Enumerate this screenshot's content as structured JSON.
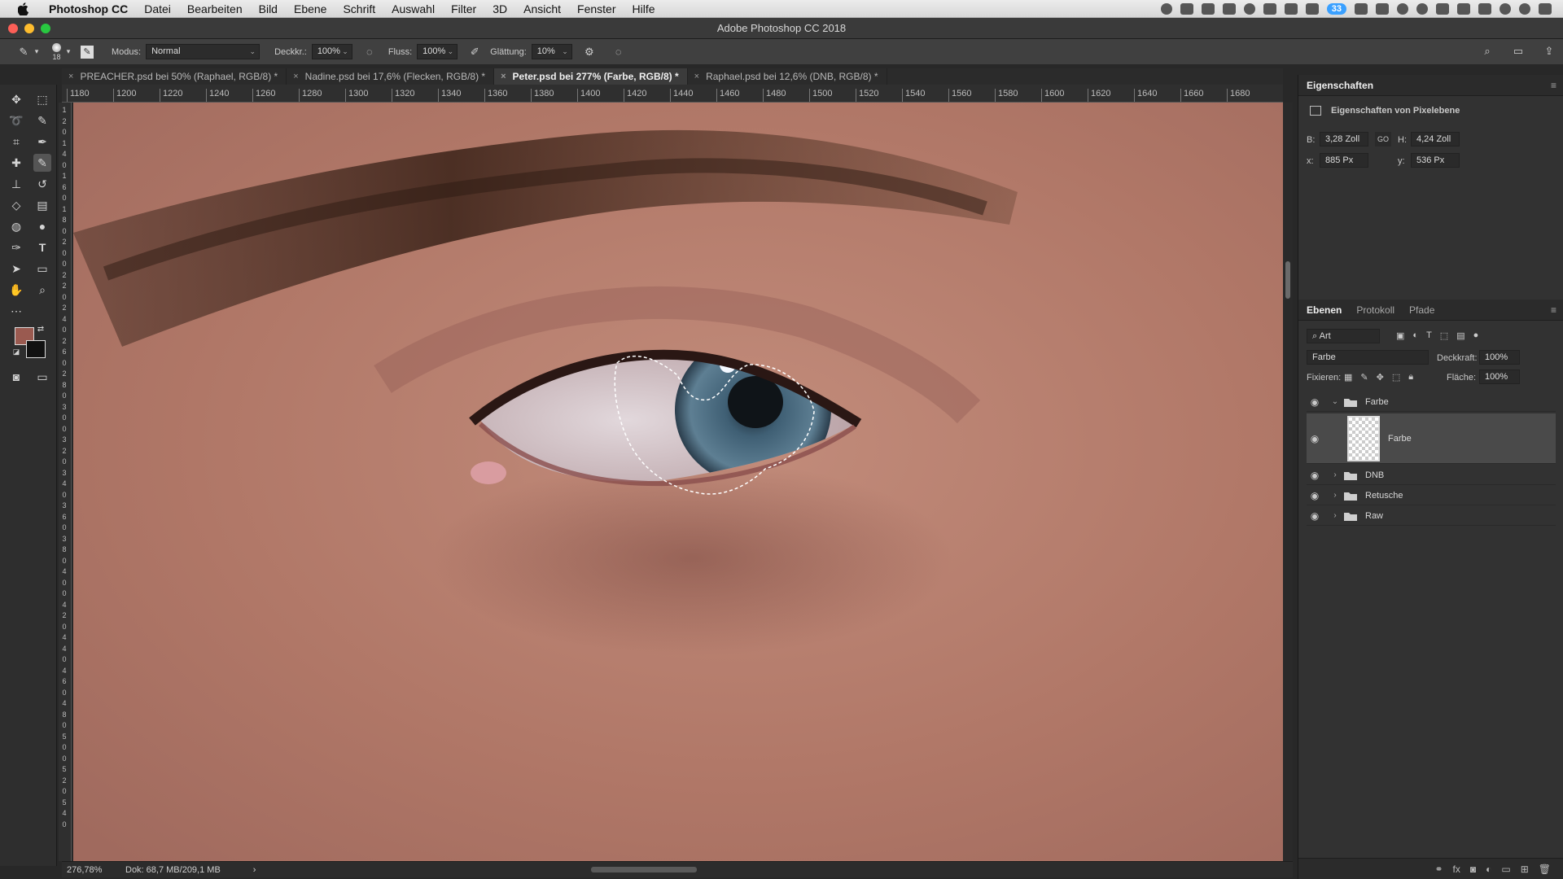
{
  "menubar": {
    "app_name": "Photoshop CC",
    "items": [
      "Datei",
      "Bearbeiten",
      "Bild",
      "Ebene",
      "Schrift",
      "Auswahl",
      "Filter",
      "3D",
      "Ansicht",
      "Fenster",
      "Hilfe"
    ],
    "battery_badge": "33"
  },
  "window": {
    "title": "Adobe Photoshop CC 2018"
  },
  "options": {
    "brush_size": "18",
    "mode_label": "Modus:",
    "mode_value": "Normal",
    "opacity_label": "Deckkr.:",
    "opacity_value": "100%",
    "flow_label": "Fluss:",
    "flow_value": "100%",
    "smoothing_label": "Glättung:",
    "smoothing_value": "10%"
  },
  "tabs": [
    {
      "label": "PREACHER.psd bei 50% (Raphael, RGB/8) *",
      "active": false
    },
    {
      "label": "Nadine.psd bei 17,6% (Flecken, RGB/8) *",
      "active": false
    },
    {
      "label": "Peter.psd bei 277% (Farbe, RGB/8) *",
      "active": true
    },
    {
      "label": "Raphael.psd bei 12,6% (DNB, RGB/8) *",
      "active": false
    }
  ],
  "ruler": {
    "h_ticks": [
      "1180",
      "1200",
      "1220",
      "1240",
      "1260",
      "1280",
      "1300",
      "1320",
      "1340",
      "1360",
      "1380",
      "1400",
      "1420",
      "1440",
      "1460",
      "1480",
      "1500",
      "1520",
      "1540",
      "1560",
      "1580",
      "1600",
      "1620",
      "1640",
      "1660",
      "1680"
    ],
    "v_ticks": [
      "1",
      "2",
      "0",
      "1",
      "4",
      "0",
      "1",
      "6",
      "0",
      "1",
      "8",
      "0",
      "2",
      "0",
      "0",
      "2",
      "2",
      "0",
      "2",
      "4",
      "0",
      "2",
      "6",
      "0",
      "2",
      "8",
      "0",
      "3",
      "0",
      "0",
      "3",
      "2",
      "0",
      "3",
      "4",
      "0",
      "3",
      "6",
      "0",
      "3",
      "8",
      "0",
      "4",
      "0",
      "0",
      "4",
      "2",
      "0",
      "4",
      "4",
      "0",
      "4",
      "6",
      "0",
      "4",
      "8",
      "0",
      "5",
      "0",
      "0",
      "5",
      "2",
      "0",
      "5",
      "4",
      "0"
    ]
  },
  "colors": {
    "foreground": "#9a5a50",
    "background": "#111111",
    "skin": "#b27a6a",
    "accent": "#3aa0ff"
  },
  "status": {
    "zoom": "276,78%",
    "doc": "Dok: 68,7 MB/209,1 MB",
    "arrow": "›"
  },
  "properties": {
    "tab": "Eigenschaften",
    "subtitle": "Eigenschaften von Pixelebene",
    "w_label": "B:",
    "w_value": "3,28 Zoll",
    "link_label": "GO",
    "h_label": "H:",
    "h_value": "4,24 Zoll",
    "x_label": "x:",
    "x_value": "885 Px",
    "y_label": "y:",
    "y_value": "536 Px"
  },
  "layers_panel": {
    "tabs": [
      "Ebenen",
      "Protokoll",
      "Pfade"
    ],
    "filter_value": "Art",
    "blend_mode": "Farbe",
    "opacity_label": "Deckkraft:",
    "opacity_value": "100%",
    "lock_label": "Fixieren:",
    "fill_label": "Fläche:",
    "fill_value": "100%",
    "layers": [
      {
        "name": "Farbe",
        "type": "group",
        "expanded": true
      },
      {
        "name": "Farbe",
        "type": "pixel",
        "selected": true
      },
      {
        "name": "DNB",
        "type": "group",
        "expanded": false
      },
      {
        "name": "Retusche",
        "type": "group",
        "expanded": false
      },
      {
        "name": "Raw",
        "type": "group",
        "expanded": false
      }
    ],
    "footer_icons": [
      "link-icon",
      "fx-icon",
      "mask-icon",
      "adjustment-icon",
      "new-group-icon",
      "new-layer-icon",
      "trash-icon"
    ]
  }
}
